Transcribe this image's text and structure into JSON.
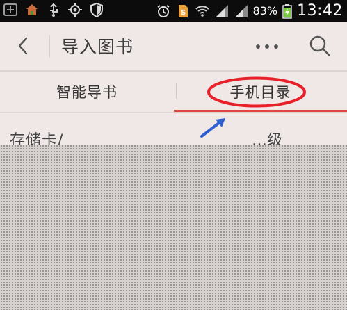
{
  "status_bar": {
    "battery_percent": "83%",
    "time": "13:42",
    "icons": [
      "grid-icon",
      "house-icon",
      "usb-icon",
      "gps-icon",
      "shield-icon",
      "alarm-icon",
      "sim-icon",
      "wifi-icon",
      "signal-icon",
      "battery-icon"
    ]
  },
  "title_bar": {
    "title": "导入图书",
    "icons": [
      "back-icon",
      "more-icon",
      "search-icon"
    ]
  },
  "tabs": [
    {
      "label": "智能导书",
      "selected": false
    },
    {
      "label": "手机目录",
      "selected": true
    }
  ],
  "content": {
    "row_text": "存储卡/",
    "row_right": "…级"
  },
  "colors": {
    "accent": "#e0473c",
    "annotation_red": "#e8202a",
    "annotation_arrow": "#2f5fd0",
    "background": "#efe8e6",
    "status_bar_bg": "#0c0c0c",
    "battery_green": "#7ac943"
  }
}
